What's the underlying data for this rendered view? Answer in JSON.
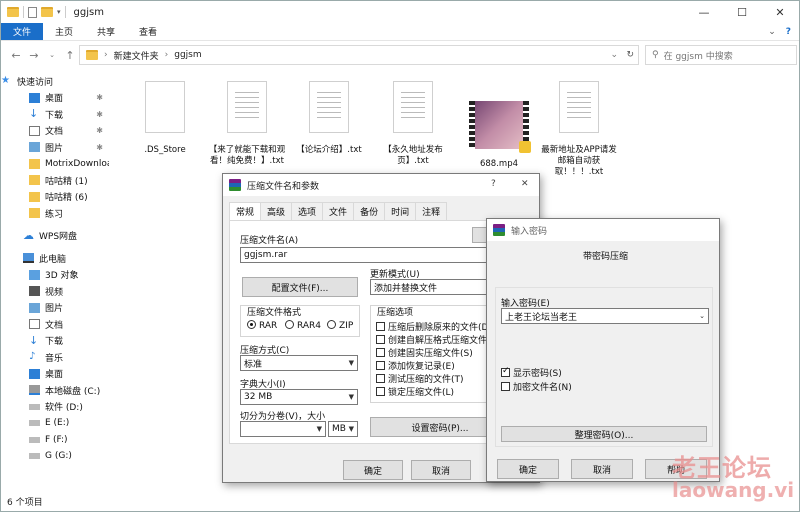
{
  "window": {
    "title": "ggjsm"
  },
  "ribbon": {
    "tabs": [
      "文件",
      "主页",
      "共享",
      "查看"
    ]
  },
  "address": {
    "crumbs": [
      "新建文件夹",
      "ggjsm"
    ],
    "search_placeholder": "在 ggjsm 中搜索"
  },
  "nav": {
    "quick_access": "快速访问",
    "items": [
      {
        "label": "桌面",
        "pinned": true,
        "icon": "desktop-icon"
      },
      {
        "label": "下载",
        "pinned": true,
        "icon": "download-icon"
      },
      {
        "label": "文档",
        "pinned": true,
        "icon": "document-icon"
      },
      {
        "label": "图片",
        "pinned": true,
        "icon": "picture-icon"
      },
      {
        "label": "MotrixDownloa",
        "pinned": false,
        "icon": "folder-icon"
      },
      {
        "label": "咕咕精 (1)",
        "pinned": false,
        "icon": "folder-icon"
      },
      {
        "label": "咕咕精 (6)",
        "pinned": false,
        "icon": "folder-icon"
      },
      {
        "label": "练习",
        "pinned": false,
        "icon": "folder-icon"
      }
    ],
    "wps": "WPS网盘",
    "this_pc": "此电脑",
    "pc_items": [
      {
        "label": "3D 对象",
        "icon": "3d-objects-icon"
      },
      {
        "label": "视频",
        "icon": "video-icon"
      },
      {
        "label": "图片",
        "icon": "picture-icon"
      },
      {
        "label": "文档",
        "icon": "document-icon"
      },
      {
        "label": "下载",
        "icon": "download-icon"
      },
      {
        "label": "音乐",
        "icon": "music-icon"
      },
      {
        "label": "桌面",
        "icon": "desktop-icon"
      },
      {
        "label": "本地磁盘 (C:)",
        "icon": "drive-icon"
      },
      {
        "label": "软件 (D:)",
        "icon": "drive-icon"
      },
      {
        "label": "E (E:)",
        "icon": "drive-icon"
      },
      {
        "label": "F (F:)",
        "icon": "drive-icon"
      },
      {
        "label": "G (G:)",
        "icon": "drive-icon"
      }
    ],
    "partial_bottom": "软件 (D:)"
  },
  "files": [
    {
      "name": ".DS_Store",
      "type": "blank"
    },
    {
      "name": "【来了就能下载和观看！纯免费！】.txt",
      "type": "txt"
    },
    {
      "name": "【论坛介绍】.txt",
      "type": "txt"
    },
    {
      "name": "【永久地址发布页】.txt",
      "type": "txt"
    },
    {
      "name": "688.mp4",
      "type": "video"
    },
    {
      "name": "最新地址及APP请发邮箱自动获取！！！.txt",
      "type": "txt"
    }
  ],
  "status": {
    "count": "6 个项目"
  },
  "archive_dialog": {
    "title": "压缩文件名和参数",
    "tabs": [
      "常规",
      "高级",
      "选项",
      "文件",
      "备份",
      "时间",
      "注释"
    ],
    "archive_name_label": "压缩文件名(A)",
    "archive_name": "ggjsm.rar",
    "browse_label": "浏",
    "profiles_label": "配置文件(F)...",
    "update_mode_label": "更新模式(U)",
    "update_mode": "添加并替换文件",
    "format_label": "压缩文件格式",
    "formats": [
      "RAR",
      "RAR4",
      "ZIP"
    ],
    "format_selected": "RAR",
    "method_label": "压缩方式(C)",
    "method": "标准",
    "dict_label": "字典大小(I)",
    "dict": "32 MB",
    "split_label": "切分为分卷(V)，大小",
    "split_unit": "MB",
    "options_label": "压缩选项",
    "options": [
      "压缩后删除原来的文件(D)",
      "创建自解压格式压缩文件(X",
      "创建固实压缩文件(S)",
      "添加恢复记录(E)",
      "测试压缩的文件(T)",
      "锁定压缩文件(L)"
    ],
    "set_password_label": "设置密码(P)...",
    "ok": "确定",
    "cancel": "取消",
    "help_q": "?",
    "close_x": "✕"
  },
  "password_dialog": {
    "title": "输入密码",
    "heading": "带密码压缩",
    "password_label": "输入密码(E)",
    "password_value": "上老王论坛当老王",
    "show_password": "显示密码(S)",
    "show_password_checked": true,
    "encrypt_names": "加密文件名(N)",
    "encrypt_names_checked": false,
    "organize_label": "整理密码(O)...",
    "ok": "确定",
    "cancel": "取消",
    "help": "帮助"
  },
  "watermark": {
    "line1": "老王论坛",
    "line2": "laowang.vi"
  }
}
